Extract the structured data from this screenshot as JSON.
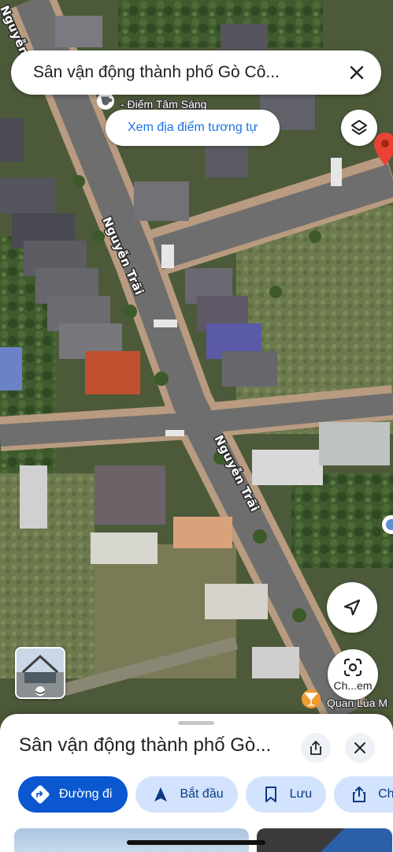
{
  "map": {
    "road_labels": [
      "Nguyễn Trãi",
      "Nguyễn Trãi",
      "Nguyễn Tr"
    ],
    "poi_labels": {
      "cafe": "- Điểm Tâm Sáng",
      "bar": "Quan Lúa M"
    }
  },
  "search": {
    "query": "Sân vận động thành phố Gò Cô...",
    "similar_places": "Xem địa điểm tương tự"
  },
  "controls": {
    "lens_label": "Ch...em"
  },
  "place_sheet": {
    "title": "Sân vận động thành phố Gò...",
    "actions": [
      {
        "label": "Đường đi",
        "icon": "directions-icon"
      },
      {
        "label": "Bắt đầu",
        "icon": "navigation-arrow-icon"
      },
      {
        "label": "Lưu",
        "icon": "bookmark-icon"
      },
      {
        "label": "Chia",
        "icon": "share-icon"
      }
    ]
  },
  "colors": {
    "accent": "#0b57d0",
    "chip_bg": "#d3e3fd",
    "link": "#1a73e8",
    "pin": "#ea4335"
  }
}
